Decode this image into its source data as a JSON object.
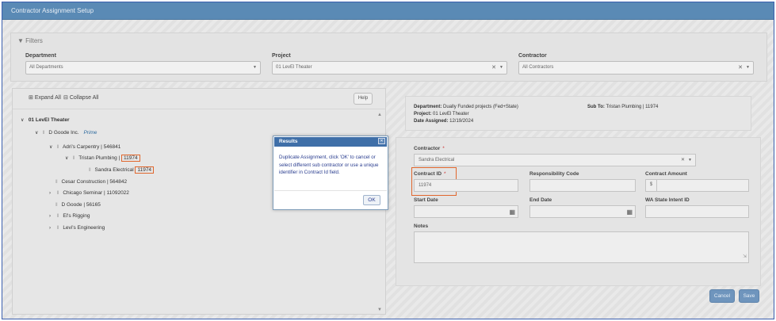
{
  "window": {
    "title": "Contractor Assignment Setup"
  },
  "filters": {
    "title": "Filters",
    "department": {
      "label": "Department",
      "value": "All Departments"
    },
    "project": {
      "label": "Project",
      "value": "01 LevEl Theater"
    },
    "contractor": {
      "label": "Contractor",
      "value": "All Contractors"
    }
  },
  "tree": {
    "expand_all": "Expand All",
    "collapse_all": "Collapse All",
    "help": "Help",
    "nodes": [
      {
        "label": "01 LevEl Theater"
      },
      {
        "label": "D Goode Inc.",
        "badge": "Prime"
      },
      {
        "label": "Adri's Carpentry | 546841"
      },
      {
        "label": "Tristan Plumbing |",
        "id": "11974"
      },
      {
        "label": "Sandra Electrical",
        "id": "11974"
      },
      {
        "label": "Cesar Construction | 564842"
      },
      {
        "label": "Chicago Seminar | 11092022"
      },
      {
        "label": "D Goode | 56165"
      },
      {
        "label": "El's Rigging"
      },
      {
        "label": "Levi's Engineering"
      }
    ]
  },
  "info": {
    "department_label": "Department:",
    "department_value": "Dually Funded projects (Fed+State)",
    "subto_label": "Sub To:",
    "subto_value": "Tristan Plumbing | 11974",
    "project_label": "Project:",
    "project_value": "01 LevEl Theater",
    "date_label": "Date Assigned:",
    "date_value": "12/19/2024"
  },
  "form": {
    "contractor": {
      "label": "Contractor",
      "required": "*",
      "value": "Sandra Electrical"
    },
    "contract_id": {
      "label": "Contract ID",
      "required": "*",
      "value": "11974"
    },
    "responsibility_code": {
      "label": "Responsibility Code",
      "value": ""
    },
    "contract_amount": {
      "label": "Contract Amount",
      "currency": "$",
      "value": ""
    },
    "start_date": {
      "label": "Start Date",
      "value": ""
    },
    "end_date": {
      "label": "End Date",
      "value": ""
    },
    "wa_state_intent_id": {
      "label": "WA State Intent ID",
      "value": ""
    },
    "notes": {
      "label": "Notes",
      "value": ""
    }
  },
  "actions": {
    "cancel": "Cancel",
    "save": "Save"
  },
  "modal": {
    "title": "Results",
    "message": "Duplicate Assignment, click 'OK' to cancel or select different sub contractor or use a unique identifier in Contract Id field.",
    "ok": "OK"
  },
  "colors": {
    "titlebar": "#5a8ab5",
    "highlight": "#e0662c",
    "modal_header": "#3f6fa8",
    "button": "#6f95bd"
  }
}
